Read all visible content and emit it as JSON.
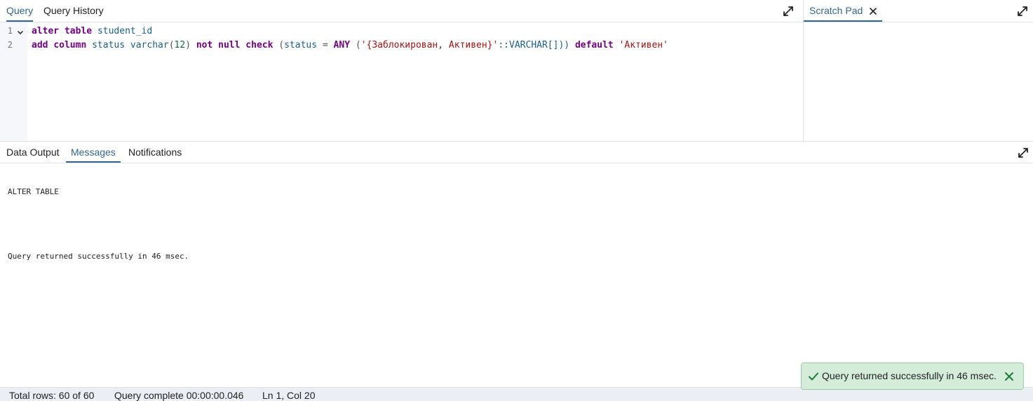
{
  "query_panel": {
    "tabs": [
      {
        "label": "Query",
        "active": true
      },
      {
        "label": "Query History",
        "active": false
      }
    ],
    "expand_icon": "expand-icon"
  },
  "scratch_panel": {
    "tab_label": "Scratch Pad",
    "close_icon": "close-icon",
    "expand_icon": "expand-icon"
  },
  "editor": {
    "line_numbers": [
      "1",
      "2"
    ],
    "line1": {
      "kw1": "alter",
      "kw2": "table",
      "ident": "student_id"
    },
    "line2": {
      "kw1": "add",
      "kw2": "column",
      "ident1": "status",
      "func": "varchar",
      "paren_open": "(",
      "num": "12",
      "paren_close": ")",
      "kw3": "not",
      "kw4": "null",
      "kw5": "check",
      "cond_open": "(",
      "ident2": "status",
      "op_eq": "=",
      "kw6": "ANY",
      "arr_open": "(",
      "str1": "'{Заблокирован, Активен}'",
      "cast": "::VARCHAR[]))",
      "kw7": "default",
      "str2": "'Активен'"
    }
  },
  "results_panel": {
    "tabs": [
      {
        "label": "Data Output",
        "active": false
      },
      {
        "label": "Messages",
        "active": true
      },
      {
        "label": "Notifications",
        "active": false
      }
    ],
    "messages": [
      "ALTER TABLE",
      "",
      "Query returned successfully in 46 msec."
    ],
    "expand_icon": "expand-icon"
  },
  "status_bar": {
    "total_rows": "Total rows: 60 of 60",
    "query_complete": "Query complete 00:00:00.046",
    "cursor_pos": "Ln 1, Col 20"
  },
  "toast": {
    "message": "Query returned successfully in 46 msec.",
    "icon": "check-icon",
    "close_icon": "close-icon"
  },
  "colors": {
    "accent": "#326690",
    "keyword": "#770088",
    "identifier": "#1a5e8a",
    "string": "#aa1111",
    "number": "#116644",
    "toast_bg": "#d4edda",
    "toast_icon": "#1d7a34"
  }
}
